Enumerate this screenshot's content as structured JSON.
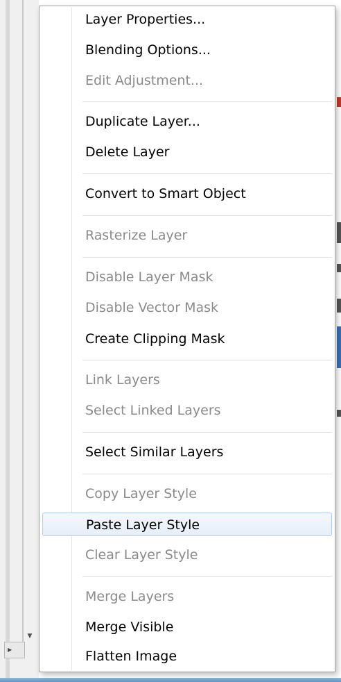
{
  "menu": {
    "items": [
      {
        "label": "Layer Properties...",
        "enabled": true
      },
      {
        "label": "Blending Options...",
        "enabled": true
      },
      {
        "label": "Edit Adjustment...",
        "enabled": false
      },
      {
        "label": "Duplicate Layer...",
        "enabled": true
      },
      {
        "label": "Delete Layer",
        "enabled": true
      },
      {
        "label": "Convert to Smart Object",
        "enabled": true
      },
      {
        "label": "Rasterize Layer",
        "enabled": false
      },
      {
        "label": "Disable Layer Mask",
        "enabled": false
      },
      {
        "label": "Disable Vector Mask",
        "enabled": false
      },
      {
        "label": "Create Clipping Mask",
        "enabled": true
      },
      {
        "label": "Link Layers",
        "enabled": false
      },
      {
        "label": "Select Linked Layers",
        "enabled": false
      },
      {
        "label": "Select Similar Layers",
        "enabled": true
      },
      {
        "label": "Copy Layer Style",
        "enabled": false
      },
      {
        "label": "Paste Layer Style",
        "enabled": true,
        "highlighted": true
      },
      {
        "label": "Clear Layer Style",
        "enabled": false
      },
      {
        "label": "Merge Layers",
        "enabled": false
      },
      {
        "label": "Merge Visible",
        "enabled": true
      },
      {
        "label": "Flatten Image",
        "enabled": true
      }
    ]
  },
  "colors": {
    "enabled_text": "#000000",
    "disabled_text": "#8a8a8a",
    "highlight_border": "#aecbf0",
    "highlight_fill": "#e6eefa"
  }
}
